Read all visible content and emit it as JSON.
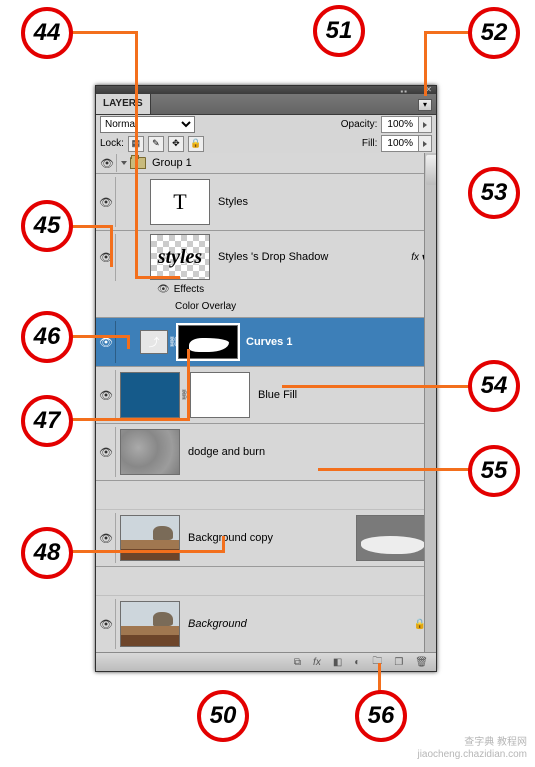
{
  "panel": {
    "title": "LAYERS",
    "blendMode": "Normal",
    "opacityLabel": "Opacity:",
    "opacityValue": "100%",
    "lockLabel": "Lock:",
    "fillLabel": "Fill:",
    "fillValue": "100%"
  },
  "group": {
    "name": "Group 1"
  },
  "layers": {
    "styles": "Styles",
    "stylesShadow": "Styles 's Drop Shadow",
    "effects": "Effects",
    "colorOverlay": "Color Overlay",
    "curves": "Curves 1",
    "blueFill": "Blue Fill",
    "dodge": "dodge and burn",
    "bgCopy": "Background copy",
    "bg": "Background"
  },
  "icons": {
    "fx": "fx",
    "link": "⛓",
    "lock": "🔒",
    "eye": "👁",
    "new": "❐",
    "trash": "🗑",
    "mask": "◧",
    "adj": "◐",
    "folder": "🗀",
    "chain": "⧉"
  },
  "callouts": {
    "c44": "44",
    "c45": "45",
    "c46": "46",
    "c47": "47",
    "c48": "48",
    "c50": "50",
    "c51": "51",
    "c52": "52",
    "c53": "53",
    "c54": "54",
    "c55": "55",
    "c56": "56"
  },
  "watermark": {
    "l1": "查字典  教程网",
    "l2": "jiaocheng.chazidian.com"
  }
}
